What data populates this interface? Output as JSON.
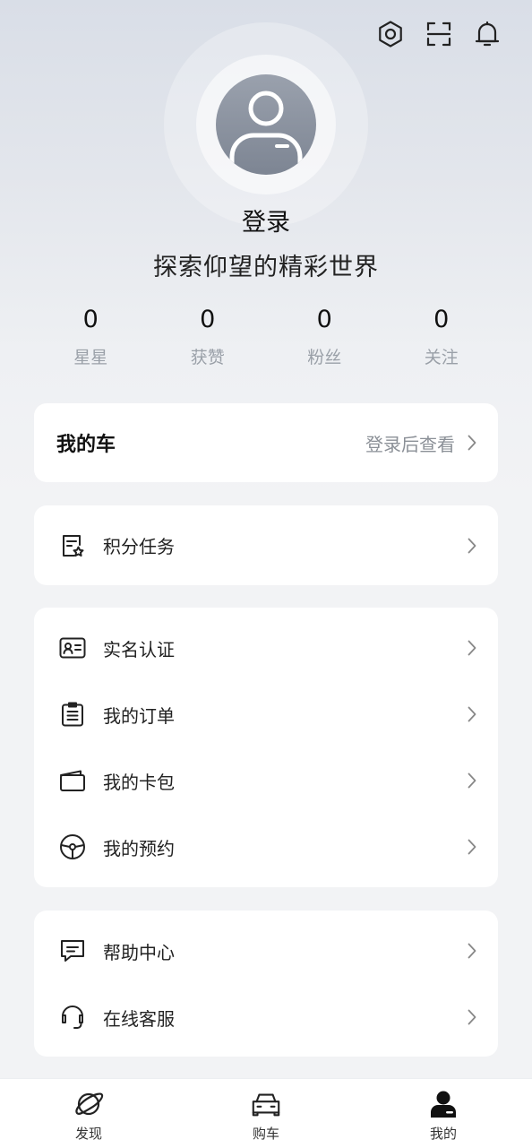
{
  "header": {
    "icons": [
      "settings-icon",
      "scan-icon",
      "bell-icon"
    ]
  },
  "profile": {
    "login_label": "登录",
    "slogan": "探索仰望的精彩世界"
  },
  "stats": [
    {
      "value": "0",
      "label": "星星"
    },
    {
      "value": "0",
      "label": "获赞"
    },
    {
      "value": "0",
      "label": "粉丝"
    },
    {
      "value": "0",
      "label": "关注"
    }
  ],
  "my_car": {
    "title": "我的车",
    "hint": "登录后查看"
  },
  "sections": {
    "tasks": [
      {
        "label": "积分任务",
        "icon": "points-task-icon"
      }
    ],
    "services": [
      {
        "label": "实名认证",
        "icon": "id-card-icon"
      },
      {
        "label": "我的订单",
        "icon": "order-icon"
      },
      {
        "label": "我的卡包",
        "icon": "wallet-icon"
      },
      {
        "label": "我的预约",
        "icon": "steering-wheel-icon"
      }
    ],
    "support": [
      {
        "label": "帮助中心",
        "icon": "message-icon"
      },
      {
        "label": "在线客服",
        "icon": "headset-icon"
      }
    ]
  },
  "tabbar": [
    {
      "label": "发现",
      "icon": "planet-icon",
      "active": false
    },
    {
      "label": "购车",
      "icon": "car-icon",
      "active": false
    },
    {
      "label": "我的",
      "icon": "person-icon",
      "active": true
    }
  ],
  "colors": {
    "background": "#f2f3f5",
    "card": "#ffffff",
    "muted_text": "#9aa0a8",
    "avatar": "#8a919e"
  }
}
